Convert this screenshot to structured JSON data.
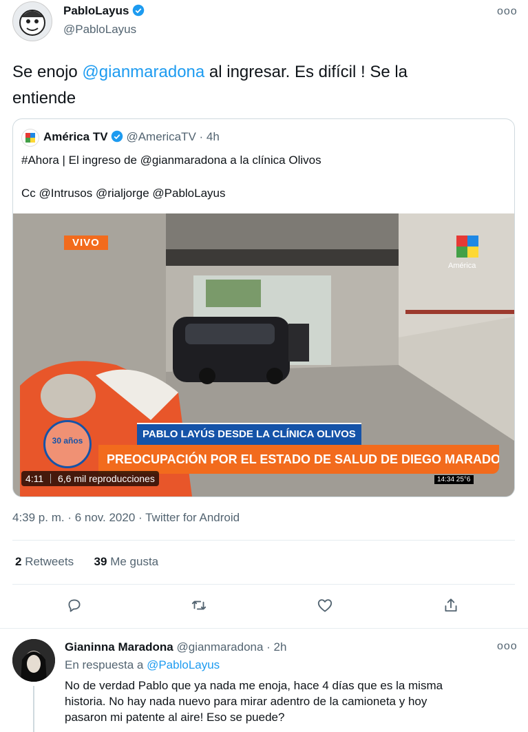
{
  "tweet": {
    "author_name": "PabloLayus",
    "author_handle": "@PabloLayus",
    "text_prefix": "Se enojo ",
    "mention": "@gianmaradona",
    "text_line1_rest": " al ingresar. Es difícil ! Se la",
    "text_line2": "entiende",
    "timestamp": "4:39 p. m. · 6 nov. 2020 · Twitter for Android",
    "retweets_count": "2",
    "retweets_label": "Retweets",
    "likes_count": "39",
    "likes_label": "Me gusta"
  },
  "quoted": {
    "author_name": "América TV",
    "handle_time": "@AmericaTV · 4h",
    "line1": "#Ahora | El ingreso de @gianmaradona a la clínica Olivos",
    "line2": "Cc @Intrusos @rialjorge @PabloLayus",
    "video": {
      "live_badge": "VIVO",
      "lower_third_top": "PABLO LAYÚS DESDE LA CLÍNICA OLIVOS",
      "lower_third_main": "PREOCUPACIÓN POR EL ESTADO DE SALUD DE DIEGO MARADONA",
      "clock": "14:34  25°6",
      "channel_logo_text": "América",
      "anniv_logo_text": "30 años",
      "duration": "4:11",
      "views": "6,6 mil reproducciones"
    }
  },
  "reply": {
    "author_name": "Gianinna Maradona",
    "handle_time": "@gianmaradona · 2h",
    "in_reply_prefix": "En respuesta a ",
    "in_reply_handle": "@PabloLayus",
    "line1": "No de verdad Pablo que ya nada me enoja, hace 4 días que es la misma",
    "line2": "historia. No hay nada nuevo para mirar adentro de la camioneta y hoy",
    "line3": "pasaron mi patente al aire! Eso se puede?"
  },
  "more_label": "ooo",
  "colors": {
    "accent": "#1d9bf0",
    "muted": "#536471",
    "lower_third_orange": "#f26b1d",
    "lower_third_blue": "#1553a8"
  }
}
